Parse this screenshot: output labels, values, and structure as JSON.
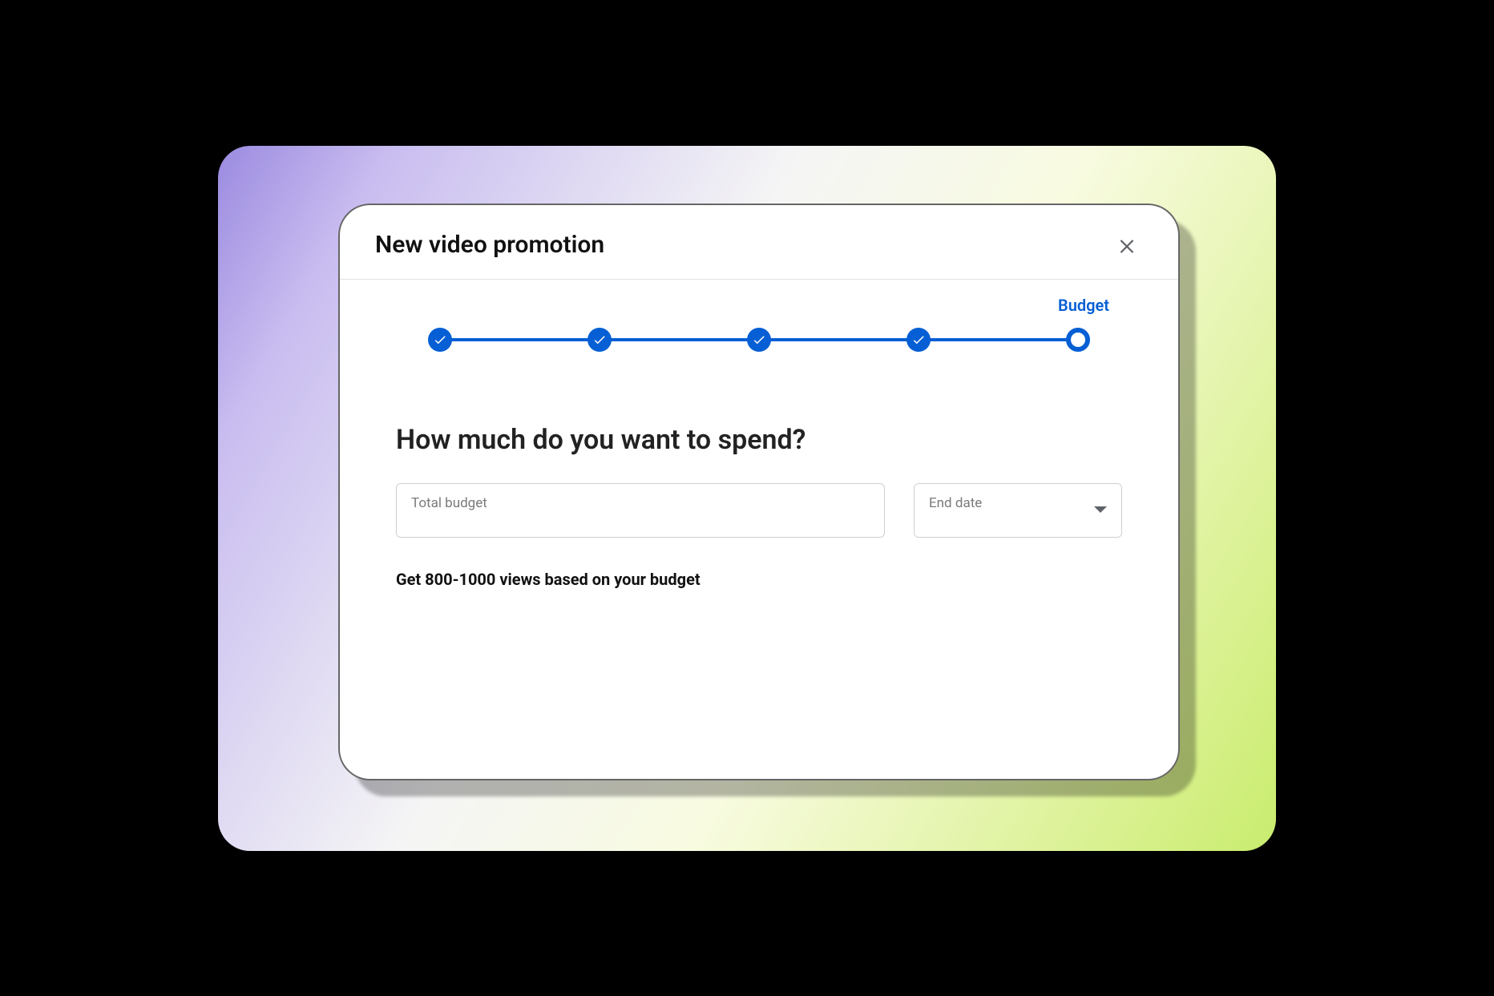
{
  "modal": {
    "title": "New video promotion"
  },
  "stepper": {
    "current_label": "Budget",
    "steps": [
      {
        "status": "complete"
      },
      {
        "status": "complete"
      },
      {
        "status": "complete"
      },
      {
        "status": "complete"
      },
      {
        "status": "current",
        "label": "Budget"
      }
    ]
  },
  "question": "How much do you want to spend?",
  "fields": {
    "budget_label": "Total budget",
    "end_date_label": "End date"
  },
  "estimate": "Get 800-1000 views based on your budget"
}
